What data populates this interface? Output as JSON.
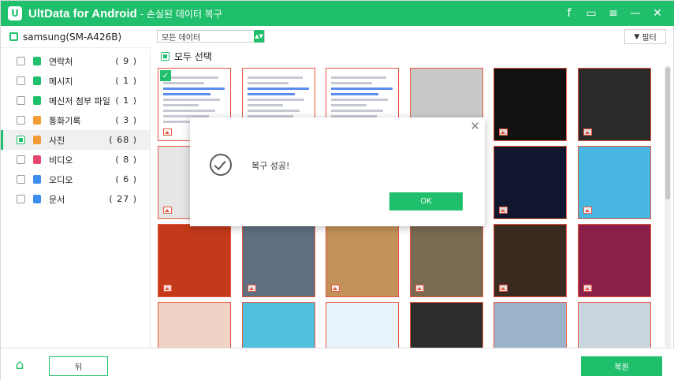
{
  "app": {
    "logo_letter": "U",
    "title": "UltData for Android",
    "subtitle": "- 손실된 데이터 복구",
    "icons": [
      "facebook-icon",
      "feedback-icon",
      "menu-icon",
      "minimize-icon",
      "close-icon"
    ],
    "icon_glyphs": [
      "f",
      "▭",
      "≡",
      "—",
      "✕"
    ]
  },
  "device": {
    "name": "samsung(SM-A426B)"
  },
  "sidebar": {
    "items": [
      {
        "label": "연락처",
        "count": "( 9 )",
        "icon": "contacts-icon",
        "color": "#20bf6b",
        "checked": false
      },
      {
        "label": "메시지",
        "count": "( 1 )",
        "icon": "message-icon",
        "color": "#20bf6b",
        "checked": false
      },
      {
        "label": "메신저 첨부 파일",
        "count": "( 1 )",
        "icon": "attachment-icon",
        "color": "#20bf6b",
        "checked": false
      },
      {
        "label": "통화기록",
        "count": "( 3 )",
        "icon": "call-log-icon",
        "color": "#f39c35",
        "checked": false
      },
      {
        "label": "사진",
        "count": "( 68 )",
        "icon": "photo-icon",
        "color": "#f39c35",
        "checked": true
      },
      {
        "label": "비디오",
        "count": "( 8 )",
        "icon": "video-icon",
        "color": "#e9486d",
        "checked": false
      },
      {
        "label": "오디오",
        "count": "( 6 )",
        "icon": "audio-icon",
        "color": "#3b8ef0",
        "checked": false
      },
      {
        "label": "문서",
        "count": "( 27 )",
        "icon": "document-icon",
        "color": "#3b8ef0",
        "checked": false
      }
    ]
  },
  "toolbar": {
    "dropdown_value": "모든 데이터",
    "filter_label": "필터",
    "select_all_label": "모두 선택"
  },
  "grid": {
    "thumbs": [
      {
        "bg": "#ffffff",
        "kind": "screenshot",
        "selected": true
      },
      {
        "bg": "#ffffff",
        "kind": "screenshot",
        "selected": false
      },
      {
        "bg": "#ffffff",
        "kind": "screenshot",
        "selected": false
      },
      {
        "bg": "#c9c9c9",
        "kind": "photo",
        "selected": false
      },
      {
        "bg": "#111111",
        "kind": "photo",
        "selected": false
      },
      {
        "bg": "#2a2a2a",
        "kind": "photo",
        "selected": false
      },
      {
        "bg": "#e6e6e6",
        "kind": "photo",
        "selected": false
      },
      {
        "bg": "#b9b6ad",
        "kind": "photo",
        "selected": false
      },
      {
        "bg": "#8a7d6a",
        "kind": "photo",
        "selected": false
      },
      {
        "bg": "#3a3e3a",
        "kind": "photo",
        "selected": false
      },
      {
        "bg": "#11172e",
        "kind": "photo",
        "selected": false
      },
      {
        "bg": "#47b6e0",
        "kind": "photo",
        "selected": false
      },
      {
        "bg": "#c23a1a",
        "kind": "photo",
        "selected": false
      },
      {
        "bg": "#5f6f80",
        "kind": "photo",
        "selected": false
      },
      {
        "bg": "#c2925a",
        "kind": "photo",
        "selected": false
      },
      {
        "bg": "#7b6a52",
        "kind": "photo",
        "selected": false
      },
      {
        "bg": "#3b2a20",
        "kind": "photo",
        "selected": false
      },
      {
        "bg": "#8a1f4a",
        "kind": "photo",
        "selected": false
      },
      {
        "bg": "#f1d3c6",
        "kind": "photo",
        "selected": false
      },
      {
        "bg": "#4fc1df",
        "kind": "photo",
        "selected": false
      },
      {
        "bg": "#e8f4fb",
        "kind": "photo",
        "selected": false
      },
      {
        "bg": "#2d2d2d",
        "kind": "photo",
        "selected": false
      },
      {
        "bg": "#9ab3c9",
        "kind": "photo",
        "selected": false
      },
      {
        "bg": "#c9d6df",
        "kind": "photo",
        "selected": false
      }
    ]
  },
  "dialog": {
    "message": "복구 성공!",
    "ok_label": "OK",
    "close_glyph": "✕"
  },
  "footer": {
    "home_glyph": "⌂",
    "back_label": "뒤",
    "recover_label": "복원"
  }
}
